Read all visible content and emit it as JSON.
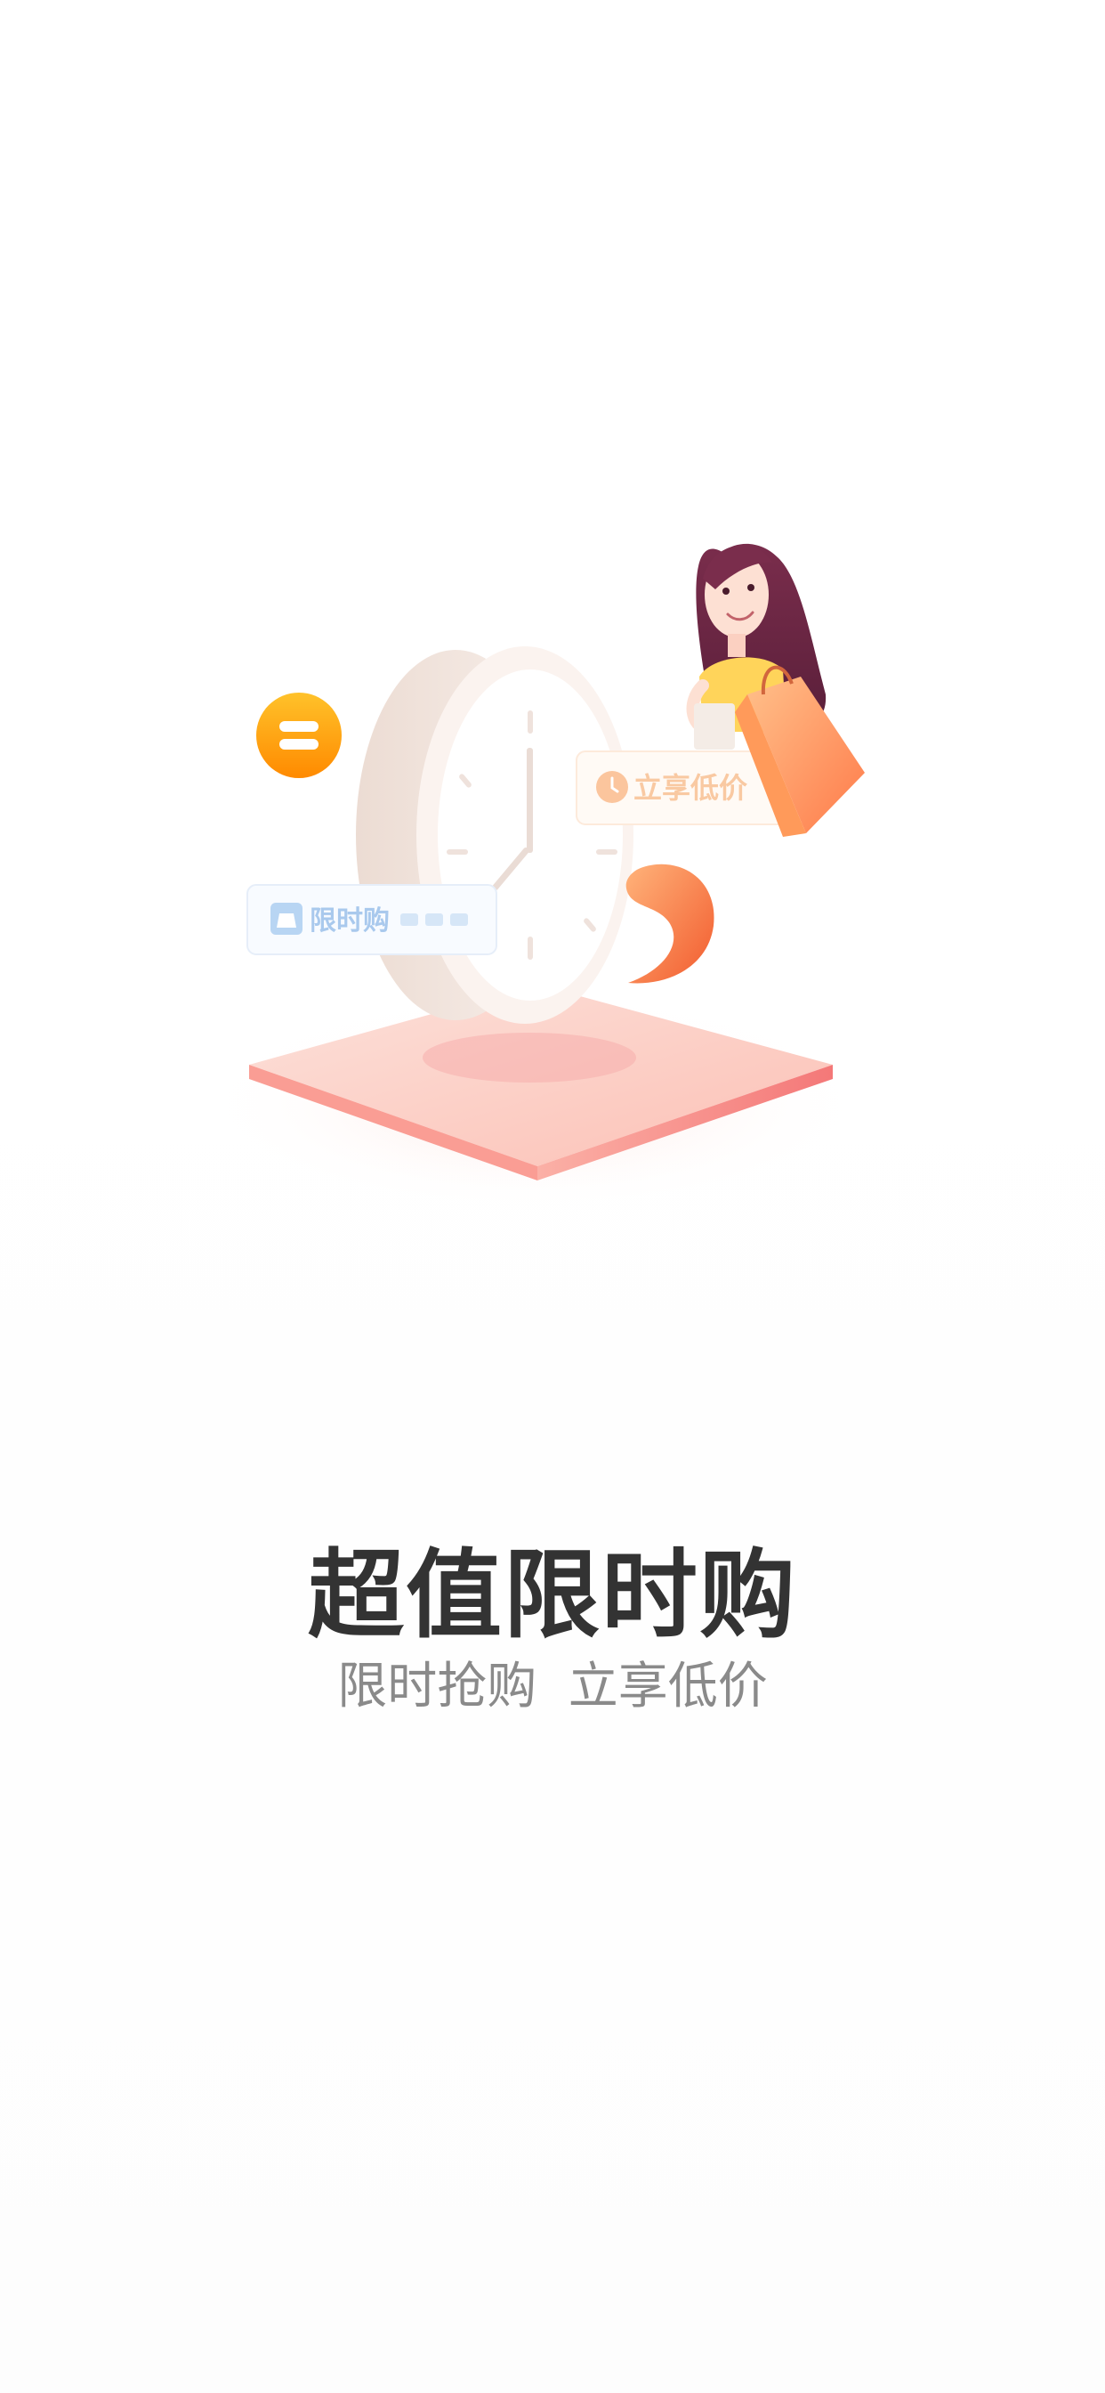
{
  "onboarding": {
    "title": "超值限时购",
    "subtitle": "限时抢购  立享低价"
  },
  "illustration": {
    "card_flash_sale_label": "限时购",
    "card_low_price_label": "立享低价",
    "icons": [
      "coupon-coin-icon",
      "clock-icon",
      "shopping-woman-icon",
      "shopping-bag-icon",
      "flame-icon"
    ]
  },
  "colors": {
    "title": "#333333",
    "subtitle": "#8a8a8a",
    "accent_orange": "#ff9f1c",
    "accent_red": "#f46a6a",
    "platform": "#fbb6ad"
  }
}
